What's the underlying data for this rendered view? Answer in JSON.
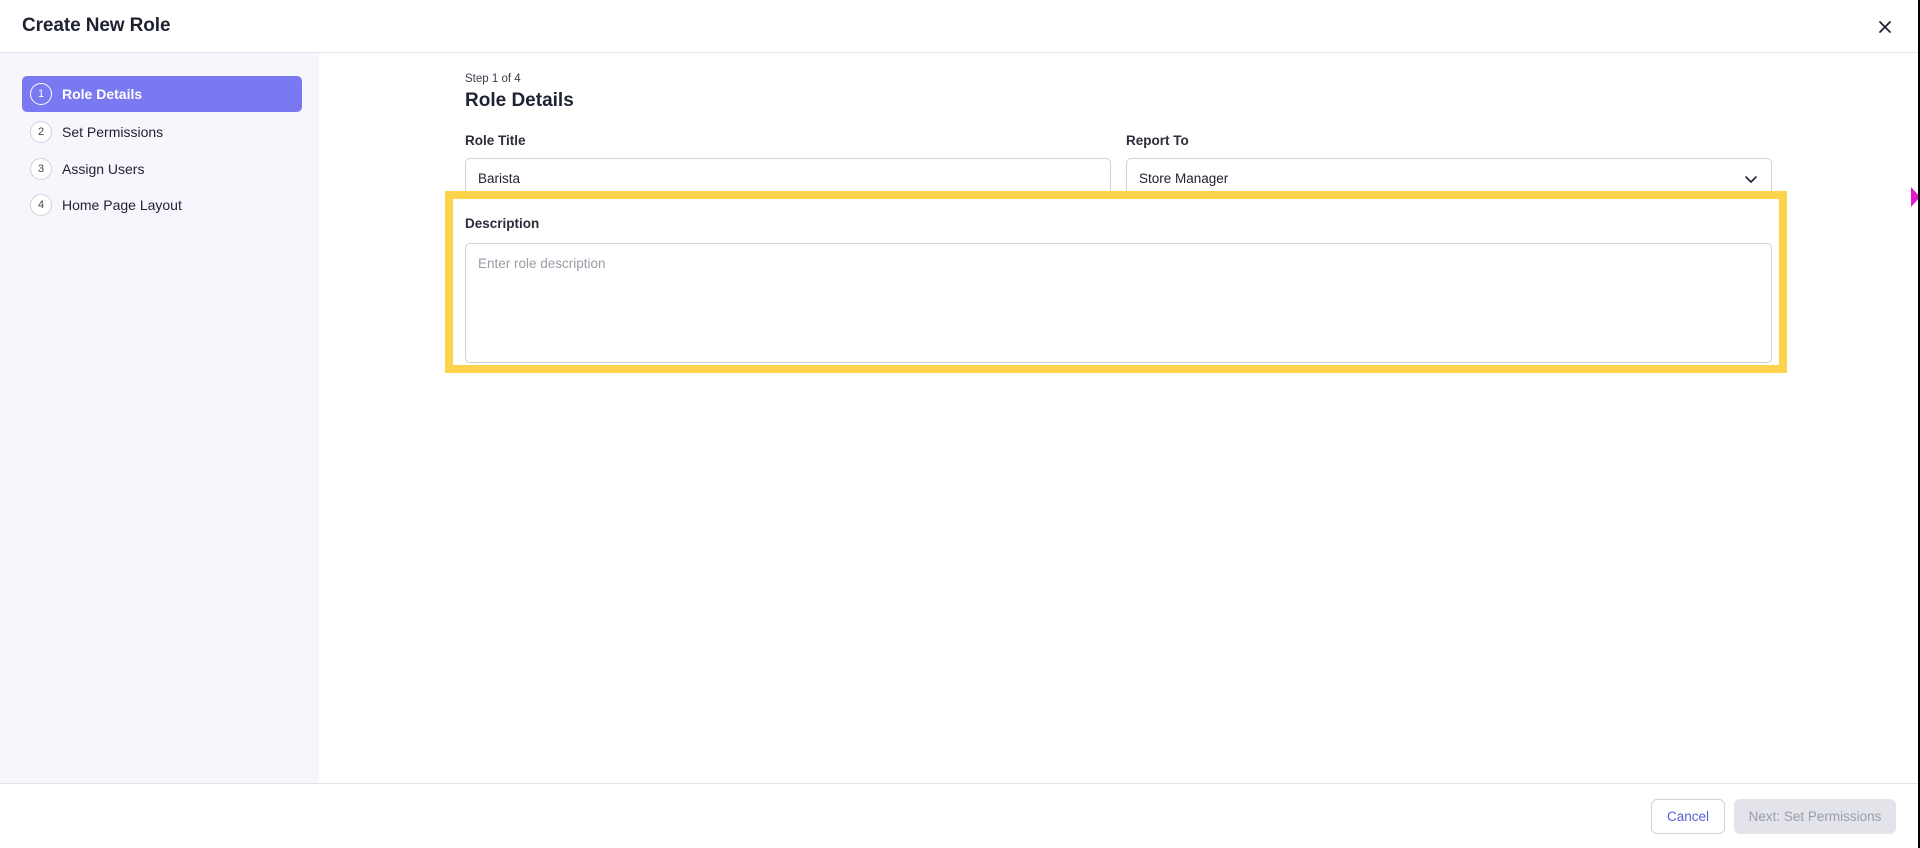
{
  "header": {
    "title": "Create New Role",
    "close_icon": "close-icon"
  },
  "sidebar": {
    "steps": [
      {
        "number": "1",
        "label": "Role Details",
        "active": true
      },
      {
        "number": "2",
        "label": "Set Permissions",
        "active": false
      },
      {
        "number": "3",
        "label": "Assign Users",
        "active": false
      },
      {
        "number": "4",
        "label": "Home Page Layout",
        "active": false
      }
    ]
  },
  "main": {
    "step_counter": "Step 1 of 4",
    "section_title": "Role Details",
    "role_title": {
      "label": "Role Title",
      "value": "Barista"
    },
    "report_to": {
      "label": "Report To",
      "value": "Store Manager",
      "icon": "chevron-down-icon"
    },
    "description": {
      "label": "Description",
      "placeholder": "Enter role description",
      "value": ""
    }
  },
  "footer": {
    "cancel_label": "Cancel",
    "next_label": "Next: Set Permissions"
  },
  "colors": {
    "accent": "#7a79f1",
    "highlight": "#fcd34a",
    "sidebar_bg": "#f6f6fc",
    "cursor": "#e31ac8"
  }
}
